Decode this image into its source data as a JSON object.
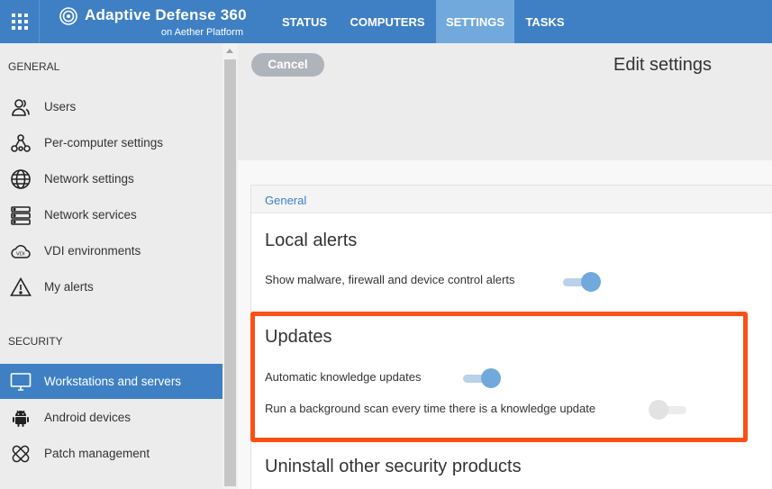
{
  "header": {
    "brand": "Adaptive Defense 360",
    "brand_sub": "on Aether Platform",
    "tabs": [
      {
        "label": "STATUS",
        "active": false
      },
      {
        "label": "COMPUTERS",
        "active": false
      },
      {
        "label": "SETTINGS",
        "active": true
      },
      {
        "label": "TASKS",
        "active": false
      }
    ],
    "colors": {
      "bar": "#3f80c4",
      "active_tab": "#71a9dd"
    }
  },
  "sidebar": {
    "general_heading": "GENERAL",
    "general_items": [
      {
        "label": "Users",
        "icon": "users-icon"
      },
      {
        "label": "Per-computer settings",
        "icon": "network-nodes-icon"
      },
      {
        "label": "Network settings",
        "icon": "globe-icon"
      },
      {
        "label": "Network services",
        "icon": "server-icon"
      },
      {
        "label": "VDI environments",
        "icon": "vdi-cloud-icon"
      },
      {
        "label": "My alerts",
        "icon": "warning-icon"
      }
    ],
    "security_heading": "SECURITY",
    "security_items": [
      {
        "label": "Workstations and servers",
        "icon": "monitor-icon",
        "active": true
      },
      {
        "label": "Android devices",
        "icon": "android-icon",
        "active": false
      },
      {
        "label": "Patch management",
        "icon": "patch-icon",
        "active": false
      }
    ]
  },
  "main": {
    "cancel_label": "Cancel",
    "page_title": "Edit settings",
    "card_heading": "General",
    "local_alerts": {
      "title": "Local alerts",
      "options": [
        {
          "label": "Show malware, firewall and device control alerts",
          "enabled": true
        }
      ]
    },
    "updates": {
      "title": "Updates",
      "options": [
        {
          "label": "Automatic knowledge updates",
          "enabled": true
        },
        {
          "label": "Run a background scan every time there is a knowledge update",
          "enabled": false
        }
      ]
    },
    "uninstall_title": "Uninstall other security products",
    "highlight_color": "#fb5016"
  }
}
